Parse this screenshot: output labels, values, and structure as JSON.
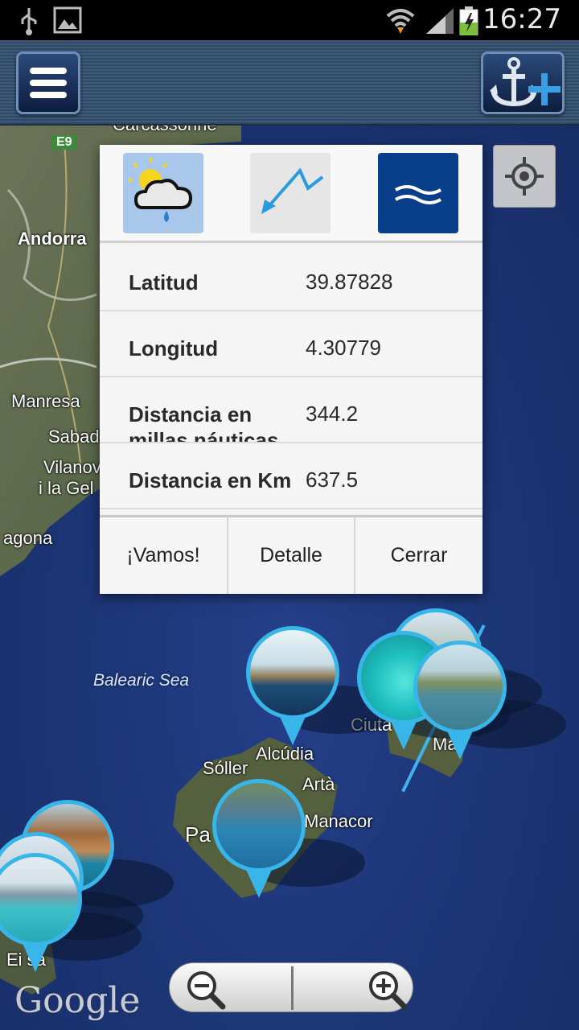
{
  "status_bar": {
    "time": "16:27"
  },
  "map": {
    "labels": {
      "carcassonne": "Carcassonne",
      "e9": "E9",
      "andorra": "Andorra",
      "manresa": "Manresa",
      "sabadell": "Sabad",
      "vilanova": "Vilanov",
      "gelt": "i la Gel",
      "tarragona": "agona",
      "balearic_sea": "Balearic Sea",
      "ciutadella": "Ciuta",
      "mao": "Ma",
      "alcudia": "Alcúdia",
      "soller": "Sóller",
      "arta": "Artà",
      "manacor": "Manacor",
      "palma": "Pa",
      "eivissa": "Ei   sa"
    },
    "google_logo": "Google"
  },
  "info_dialog": {
    "icons": [
      "weather-icon",
      "route-arrow-icon",
      "sea-waves-icon"
    ],
    "rows": [
      {
        "label": "Latitud",
        "value": "39.87828"
      },
      {
        "label": "Longitud",
        "value": "4.30779"
      },
      {
        "label": "Distancia en millas náuticas",
        "value": "344.2"
      },
      {
        "label": "Distancia en Km",
        "value": "637.5"
      }
    ],
    "actions": {
      "go": "¡Vamos!",
      "detail": "Detalle",
      "close": "Cerrar"
    }
  },
  "colors": {
    "accent": "#38b6ea",
    "sea_icon_bg": "#093f8a",
    "weather_icon_bg": "#a9c7eb"
  }
}
